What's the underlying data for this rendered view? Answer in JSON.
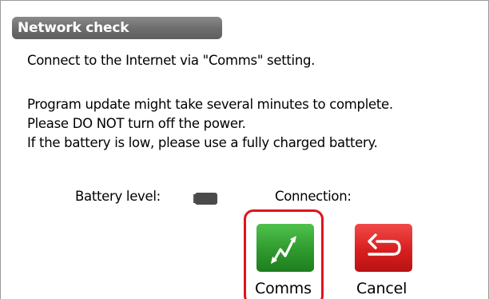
{
  "dialog": {
    "title": "Network check"
  },
  "messages": {
    "line1": "Connect to the Internet via \"Comms\" setting.",
    "line2": "Program update might take several minutes to complete.",
    "line3": "Please DO NOT turn off the power.",
    "line4": "If the battery is low, please use a fully charged battery."
  },
  "status": {
    "battery_label": "Battery level:",
    "battery_icon": "battery-icon",
    "connection_label": "Connection:"
  },
  "buttons": {
    "comms": {
      "label": "Comms",
      "icon": "signal-icon",
      "color": "#2f9a2e",
      "highlight_color": "#e0141b"
    },
    "cancel": {
      "label": "Cancel",
      "icon": "return-arrow-icon",
      "color": "#d81f1f"
    }
  }
}
